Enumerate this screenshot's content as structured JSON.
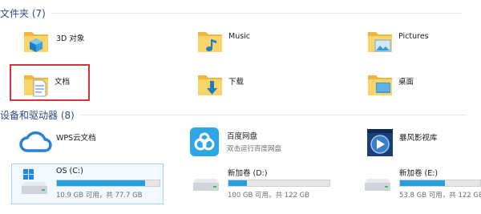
{
  "sections": {
    "folders": {
      "title": "文件夹 (7)"
    },
    "devices": {
      "title": "设备和驱动器 (8)"
    }
  },
  "folders": [
    {
      "label": "3D 对象",
      "icon": "folder-3d-objects-icon"
    },
    {
      "label": "Music",
      "icon": "folder-music-icon"
    },
    {
      "label": "Pictures",
      "icon": "folder-pictures-icon"
    },
    {
      "label": "文档",
      "icon": "folder-documents-icon"
    },
    {
      "label": "下载",
      "icon": "folder-downloads-icon"
    },
    {
      "label": "桌面",
      "icon": "folder-desktop-icon"
    }
  ],
  "apps": [
    {
      "label": "WPS云文档",
      "sub": "",
      "icon": "wps-cloud-icon"
    },
    {
      "label": "百度网盘",
      "sub": "双击运行百度网盘",
      "icon": "baidu-netdisk-icon"
    },
    {
      "label": "暴风影视库",
      "sub": "",
      "icon": "baofeng-library-icon"
    }
  ],
  "drives": [
    {
      "label": "OS (C:)",
      "usage": "10.9 GB 可用，共 77.7 GB",
      "used_fraction": 0.86,
      "icon": "windows-drive-icon"
    },
    {
      "label": "新加卷 (D:)",
      "usage": "100 GB 可用，共 122 GB",
      "used_fraction": 0.18,
      "icon": "drive-icon"
    },
    {
      "label": "新加卷 (E:)",
      "usage": "53.8 GB 可用，共 122 GB",
      "used_fraction": 0.56,
      "icon": "drive-icon"
    }
  ],
  "colors": {
    "accent": "#26a0da",
    "selection": "#d2333c",
    "folder": "#f4c84a"
  }
}
